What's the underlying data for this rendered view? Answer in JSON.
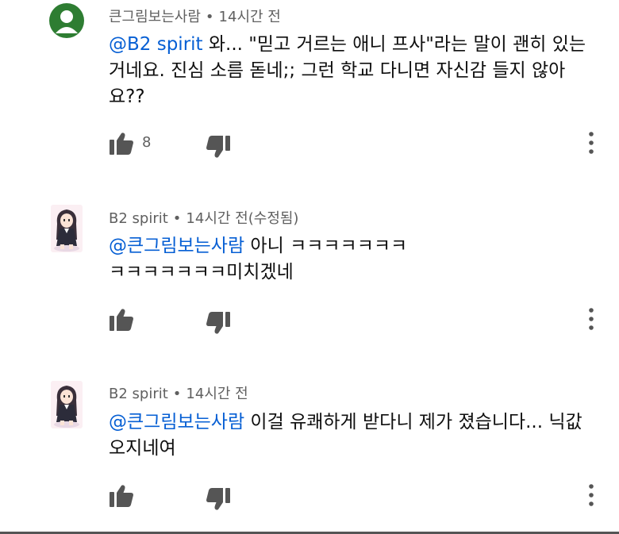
{
  "comments": [
    {
      "author": "큰그림보는사람",
      "time": "14시간 전",
      "edited": "",
      "mention": "@B2 spirit",
      "text": " 와... \"믿고 거르는 애니 프사\"라는 말이 괜히 있는거네요. 진심 소름 돋네;; 그런 학교 다니면 자신감 들지 않아요??",
      "likes": "8",
      "avatar_icon": "default-avatar-icon",
      "avatar_color": "#2e7d32"
    },
    {
      "author": "B2 spirit",
      "time": "14시간 전",
      "edited": "(수정됨)",
      "mention": "@큰그림보는사람",
      "text": " 아니 ㅋㅋㅋㅋㅋㅋㅋㅋㅋㅋㅋㅋㅋㅋ미치겠네",
      "likes": "",
      "avatar_icon": "anime-avatar-icon"
    },
    {
      "author": "B2 spirit",
      "time": "14시간 전",
      "edited": "",
      "mention": "@큰그림보는사람",
      "text": " 이걸 유쾌하게 받다니 제가 졌습니다... 닉값 오지네여",
      "likes": "",
      "avatar_icon": "anime-avatar-icon"
    }
  ],
  "separator": "•",
  "colors": {
    "text": "#0f0f0f",
    "secondary": "#606060",
    "mention": "#065fd4",
    "icon": "#555555"
  }
}
